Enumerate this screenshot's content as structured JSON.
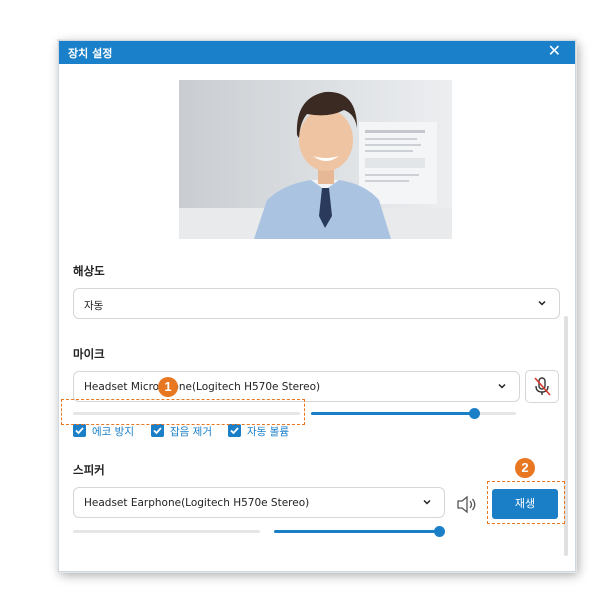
{
  "dialog": {
    "title": "장치 설정",
    "close_glyph": "✕"
  },
  "resolution": {
    "label": "해상도",
    "selected": "자동"
  },
  "microphone": {
    "label": "마이크",
    "selected": "Headset Microphone(Logitech H570e Stereo)",
    "volume_level": 0.8,
    "input_level": 0.0,
    "options": [
      "에코 방지",
      "잡음 제거",
      "자동 볼륨"
    ]
  },
  "speaker": {
    "label": "스피커",
    "selected": "Headset Earphone(Logitech H570e Stereo)",
    "volume_level": 1.0,
    "output_level": 0.0,
    "play_label": "재생"
  },
  "annotations": {
    "badge1": "1",
    "badge2": "2",
    "color": "#e87722"
  },
  "colors": {
    "accent": "#1b7fc8",
    "titlebar": "#1a80c9"
  },
  "icons": [
    "close-icon",
    "chevron-down-icon",
    "mic-muted-icon",
    "speaker-icon",
    "checkbox-icon"
  ]
}
